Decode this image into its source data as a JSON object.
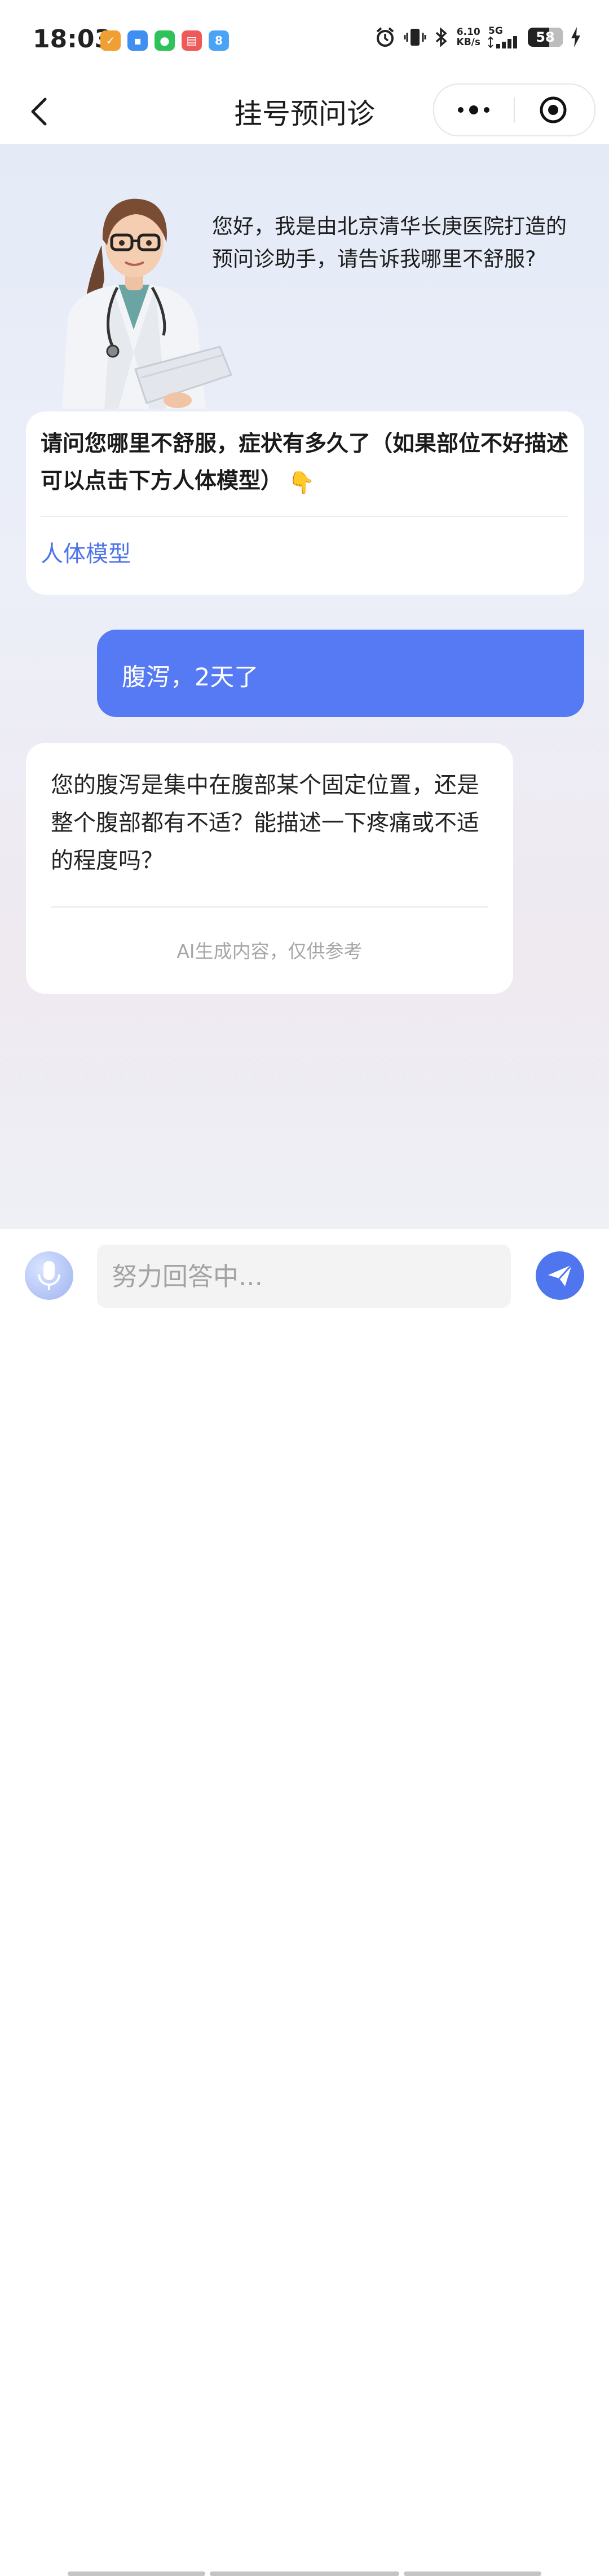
{
  "status_bar": {
    "time": "18:03",
    "app_icons": [
      {
        "name": "taobao-app-icon",
        "color": "#f0a032",
        "glyph": "✓"
      },
      {
        "name": "cloud-app-icon",
        "color": "#3f8ff0",
        "glyph": "▪"
      },
      {
        "name": "wechat-app-icon",
        "color": "#2fc25b",
        "glyph": "●"
      },
      {
        "name": "calendar-app-icon",
        "color": "#ee5a5a",
        "glyph": "▤"
      },
      {
        "name": "app-icon-8",
        "color": "#4aa3f5",
        "glyph": "8"
      }
    ],
    "net_speed_value": "6.10",
    "net_speed_unit": "KB/s",
    "network": "5G",
    "battery": "58"
  },
  "nav": {
    "title": "挂号预问诊"
  },
  "chat": {
    "greeting": "您好，我是由北京清华长庚医院打造的预问诊助手，请告诉我哪里不舒服?",
    "assistant_question": "请问您哪里不舒服，症状有多久了（如果部位不好描述可以点击下方人体模型）",
    "pointing_emoji": "👇",
    "body_model_link": "人体模型",
    "user_message": "腹泻，2天了",
    "assistant_reply": "您的腹泻是集中在腹部某个固定位置，还是整个腹部都有不适？能描述一下疼痛或不适的程度吗？",
    "ai_disclaimer": "AI生成内容，仅供参考"
  },
  "input": {
    "placeholder": "努力回答中..."
  },
  "colors": {
    "accent": "#5679f4",
    "link": "#4d73e8",
    "send_button": "#4f76ef"
  }
}
